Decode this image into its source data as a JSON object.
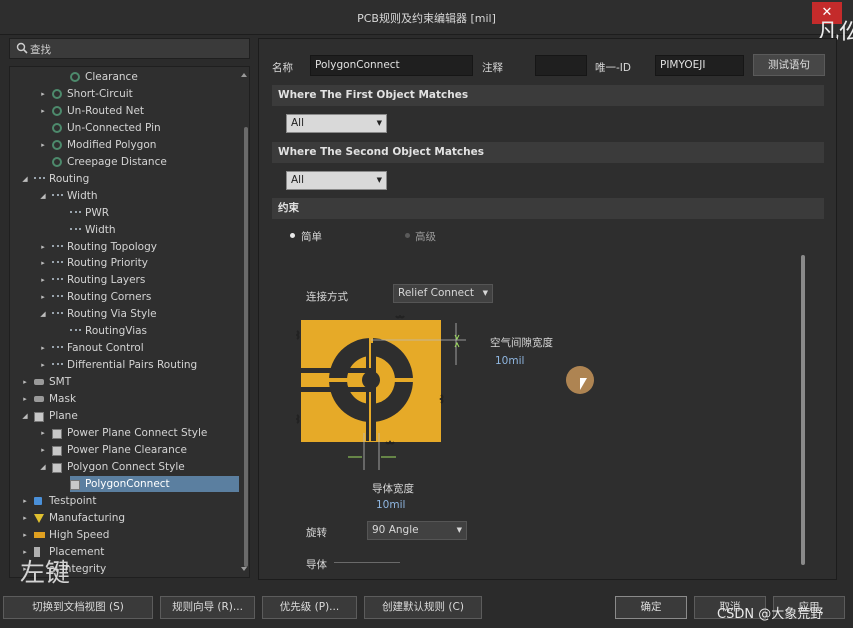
{
  "window": {
    "title": "PCB规则及约束编辑器 [mil]",
    "close_glyph": "✕"
  },
  "watermarks": {
    "top_right": "凡仫",
    "left_bottom": "左键",
    "bottom_right": "CSDN @大象荒野"
  },
  "search": {
    "label": "查找"
  },
  "tree": [
    {
      "label": "Clearance",
      "level": 3,
      "icon": "rule-icon",
      "expander": ""
    },
    {
      "label": "Short-Circuit",
      "level": 2,
      "icon": "rule-icon",
      "expander": "▸"
    },
    {
      "label": "Un-Routed Net",
      "level": 2,
      "icon": "rule-icon",
      "expander": "▸"
    },
    {
      "label": "Un-Connected Pin",
      "level": 2,
      "icon": "rule-icon",
      "expander": ""
    },
    {
      "label": "Modified Polygon",
      "level": 2,
      "icon": "rule-icon",
      "expander": "▸"
    },
    {
      "label": "Creepage Distance",
      "level": 2,
      "icon": "rule-icon",
      "expander": ""
    },
    {
      "label": "Routing",
      "level": 1,
      "icon": "route-icon",
      "expander": "◢"
    },
    {
      "label": "Width",
      "level": 2,
      "icon": "route-icon",
      "expander": "◢"
    },
    {
      "label": "PWR",
      "level": 3,
      "icon": "route-icon",
      "expander": ""
    },
    {
      "label": "Width",
      "level": 3,
      "icon": "route-icon",
      "expander": ""
    },
    {
      "label": "Routing Topology",
      "level": 2,
      "icon": "route-icon",
      "expander": "▸"
    },
    {
      "label": "Routing Priority",
      "level": 2,
      "icon": "route-icon",
      "expander": "▸"
    },
    {
      "label": "Routing Layers",
      "level": 2,
      "icon": "route-icon",
      "expander": "▸"
    },
    {
      "label": "Routing Corners",
      "level": 2,
      "icon": "route-icon",
      "expander": "▸"
    },
    {
      "label": "Routing Via Style",
      "level": 2,
      "icon": "route-icon",
      "expander": "◢"
    },
    {
      "label": "RoutingVias",
      "level": 3,
      "icon": "route-icon",
      "expander": ""
    },
    {
      "label": "Fanout Control",
      "level": 2,
      "icon": "route-icon",
      "expander": "▸"
    },
    {
      "label": "Differential Pairs Routing",
      "level": 2,
      "icon": "route-icon",
      "expander": "▸"
    },
    {
      "label": "SMT",
      "level": 1,
      "icon": "smt-icon",
      "expander": "▸"
    },
    {
      "label": "Mask",
      "level": 1,
      "icon": "smt-icon",
      "expander": "▸"
    },
    {
      "label": "Plane",
      "level": 1,
      "icon": "grid-icon",
      "expander": "◢"
    },
    {
      "label": "Power Plane Connect Style",
      "level": 2,
      "icon": "grid-icon",
      "expander": "▸"
    },
    {
      "label": "Power Plane Clearance",
      "level": 2,
      "icon": "grid-icon",
      "expander": "▸"
    },
    {
      "label": "Polygon Connect Style",
      "level": 2,
      "icon": "grid-icon",
      "expander": "◢"
    },
    {
      "label": "PolygonConnect",
      "level": 3,
      "icon": "grid-icon",
      "expander": "",
      "selected": true
    },
    {
      "label": "Testpoint",
      "level": 1,
      "icon": "test-icon",
      "expander": "▸"
    },
    {
      "label": "Manufacturing",
      "level": 1,
      "icon": "manu-icon",
      "expander": "▸"
    },
    {
      "label": "High Speed",
      "level": 1,
      "icon": "high-icon",
      "expander": "▸"
    },
    {
      "label": "Placement",
      "level": 1,
      "icon": "place-icon",
      "expander": "▸"
    },
    {
      "label": "al Integrity",
      "level": 1,
      "icon": "",
      "expander": "▸"
    }
  ],
  "rule": {
    "name_label": "名称",
    "name_value": "PolygonConnect",
    "comment_label": "注释",
    "comment_value": "",
    "uid_label": "唯一-ID",
    "uid_value": "PIMYOEJI",
    "test_button": "测试语句"
  },
  "first_match": {
    "title": "Where The First Object Matches",
    "select": "All"
  },
  "second_match": {
    "title": "Where The Second Object Matches",
    "select": "All"
  },
  "constraints": {
    "title": "约束",
    "radio_simple": "简单",
    "radio_advanced": "高级",
    "connect_label": "连接方式",
    "connect_value": "Relief Connect",
    "air_gap_label": "空气间隙宽度",
    "air_gap_value": "10mil",
    "conductor_width_label": "导体宽度",
    "conductor_width_value": "10mil",
    "rotation_label": "旋转",
    "rotation_value": "90 Angle",
    "conductors_label": "导体"
  },
  "bottom": {
    "switch_view": "切换到文档视图 (S)",
    "rule_wizard": "规则向导 (R)...",
    "priority": "优先级 (P)...",
    "create_default": "创建默认规则 (C)",
    "ok": "确定",
    "cancel": "取消",
    "apply": "应用"
  },
  "colors": {
    "accent_selected": "#5b7fa0",
    "thermal_copper": "#e6aa28",
    "value_blue": "#8fb6e0"
  }
}
